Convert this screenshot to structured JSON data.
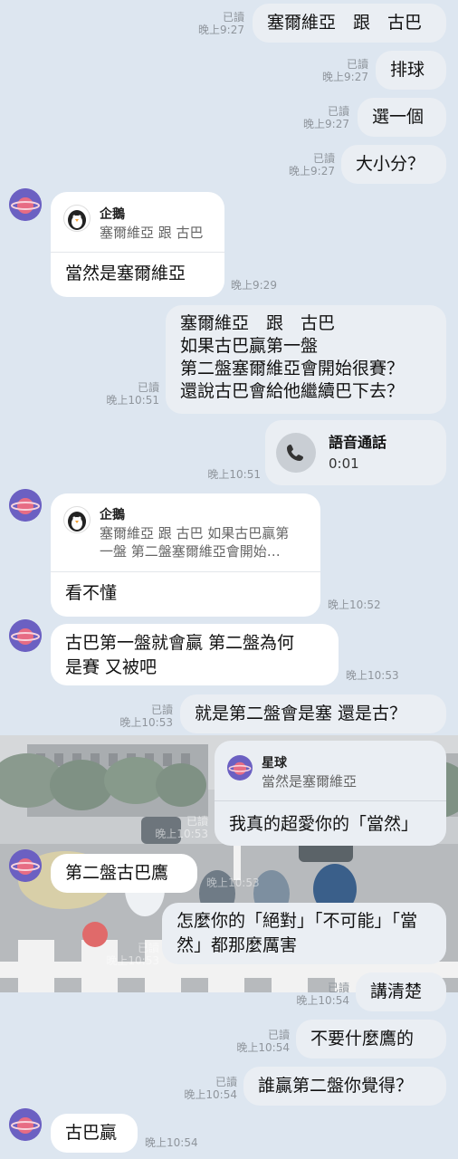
{
  "messages": [
    {
      "text": "塞爾維亞　跟　古巴",
      "read": "已讀",
      "time": "晚上9:27"
    },
    {
      "text": "排球",
      "read": "已讀",
      "time": "晚上9:27"
    },
    {
      "text": "選一個",
      "read": "已讀",
      "time": "晚上9:27"
    },
    {
      "text": "大小分？",
      "read": "已讀",
      "time": "晚上9:27"
    },
    {
      "quote_name": "企鵝",
      "quote_text": "塞爾維亞 跟 古巴",
      "text": "當然是塞爾維亞",
      "time": "晚上9:29"
    },
    {
      "lines": [
        "塞爾維亞　跟　古巴",
        "如果古巴贏第一盤",
        "第二盤塞爾維亞會開始很賽？",
        "還說古巴會給他繼續巴下去？"
      ],
      "read": "已讀",
      "time": "晚上10:51"
    },
    {
      "call_title": "語音通話",
      "call_duration": "0:01",
      "time": "晚上10:51"
    },
    {
      "quote_name": "企鵝",
      "quote_lines": [
        "塞爾維亞 跟 古巴 如果古巴贏第",
        "一盤 第二盤塞爾維亞會開始…"
      ],
      "text": "看不懂",
      "time": "晚上10:52"
    },
    {
      "lines": [
        "古巴第一盤就會贏 第二盤為何",
        "是賽 又被吧"
      ],
      "time": "晚上10:53"
    },
    {
      "text": "就是第二盤會是塞 還是古？",
      "read": "已讀",
      "time": "晚上10:53"
    },
    {
      "quote_name": "星球",
      "quote_text": "當然是塞爾維亞",
      "text": "我真的超愛你的「當然」",
      "read": "已讀",
      "time": "晚上10:53"
    },
    {
      "text": "第二盤古巴鷹",
      "time": "晚上10:53"
    },
    {
      "lines": [
        "怎麼你的「絕對」「不可能」「當",
        "然」都那麼厲害"
      ],
      "read": "已讀",
      "time": "晚上10:53"
    },
    {
      "text": "講清楚",
      "read": "已讀",
      "time": "晚上10:54"
    },
    {
      "text": "不要什麼鷹的",
      "read": "已讀",
      "time": "晚上10:54"
    },
    {
      "text": "誰贏第二盤你覺得？",
      "read": "已讀",
      "time": "晚上10:54"
    },
    {
      "text": "古巴贏",
      "time": "晚上10:54"
    }
  ]
}
